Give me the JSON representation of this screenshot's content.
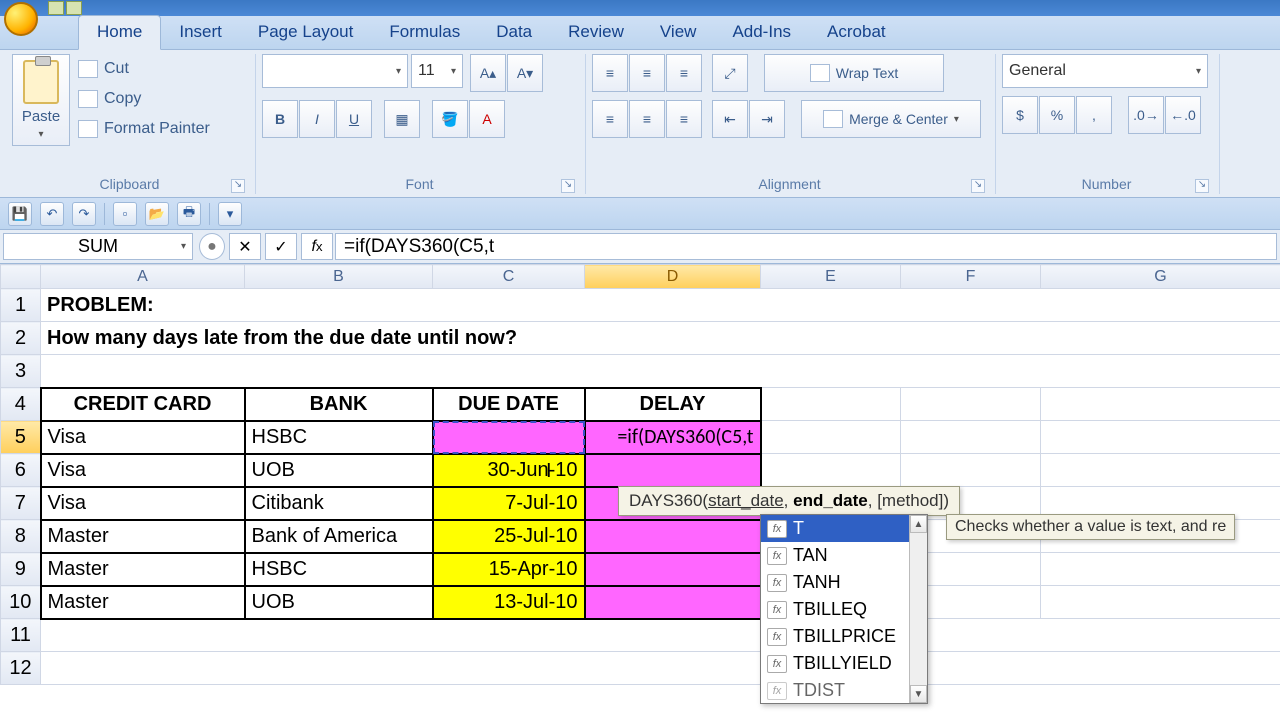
{
  "ribbon": {
    "tabs": [
      "Home",
      "Insert",
      "Page Layout",
      "Formulas",
      "Data",
      "Review",
      "View",
      "Add-Ins",
      "Acrobat"
    ],
    "active_tab": "Home",
    "clipboard": {
      "label": "Clipboard",
      "paste": "Paste",
      "cut": "Cut",
      "copy": "Copy",
      "painter": "Format Painter"
    },
    "font": {
      "label": "Font",
      "size": "11"
    },
    "alignment": {
      "label": "Alignment",
      "wrap": "Wrap Text",
      "merge": "Merge & Center"
    },
    "number": {
      "label": "Number",
      "format": "General"
    }
  },
  "formula_bar": {
    "name_box": "SUM",
    "formula": "=if(DAYS360(C5,t"
  },
  "columns": [
    "A",
    "B",
    "C",
    "D",
    "E",
    "F",
    "G"
  ],
  "rows": {
    "title": "PROBLEM:",
    "question": "How many days late from the due date until now?",
    "headers": {
      "A": "CREDIT CARD",
      "B": "BANK",
      "C": "DUE DATE",
      "D": "DELAY"
    },
    "data": [
      {
        "n": 5,
        "card": "Visa",
        "bank": "HSBC",
        "due": "",
        "delay": "=if(DAYS360(C5,t"
      },
      {
        "n": 6,
        "card": "Visa",
        "bank": "UOB",
        "due": "30-Jun-10",
        "delay": ""
      },
      {
        "n": 7,
        "card": "Visa",
        "bank": "Citibank",
        "due": "7-Jul-10",
        "delay": ""
      },
      {
        "n": 8,
        "card": "Master",
        "bank": "Bank of America",
        "due": "25-Jul-10",
        "delay": ""
      },
      {
        "n": 9,
        "card": "Master",
        "bank": "HSBC",
        "due": "15-Apr-10",
        "delay": ""
      },
      {
        "n": 10,
        "card": "Master",
        "bank": "UOB",
        "due": "13-Jul-10",
        "delay": ""
      }
    ]
  },
  "tooltip": {
    "prefix": "DAYS360(",
    "arg1": "start_date",
    "sep": ", ",
    "arg2": "end_date",
    "rest": ", [method])"
  },
  "autocomplete": {
    "items": [
      "T",
      "TAN",
      "TANH",
      "TBILLEQ",
      "TBILLPRICE",
      "TBILLYIELD",
      "TDIST"
    ],
    "selected": "T",
    "description": "Checks whether a value is text, and re"
  }
}
